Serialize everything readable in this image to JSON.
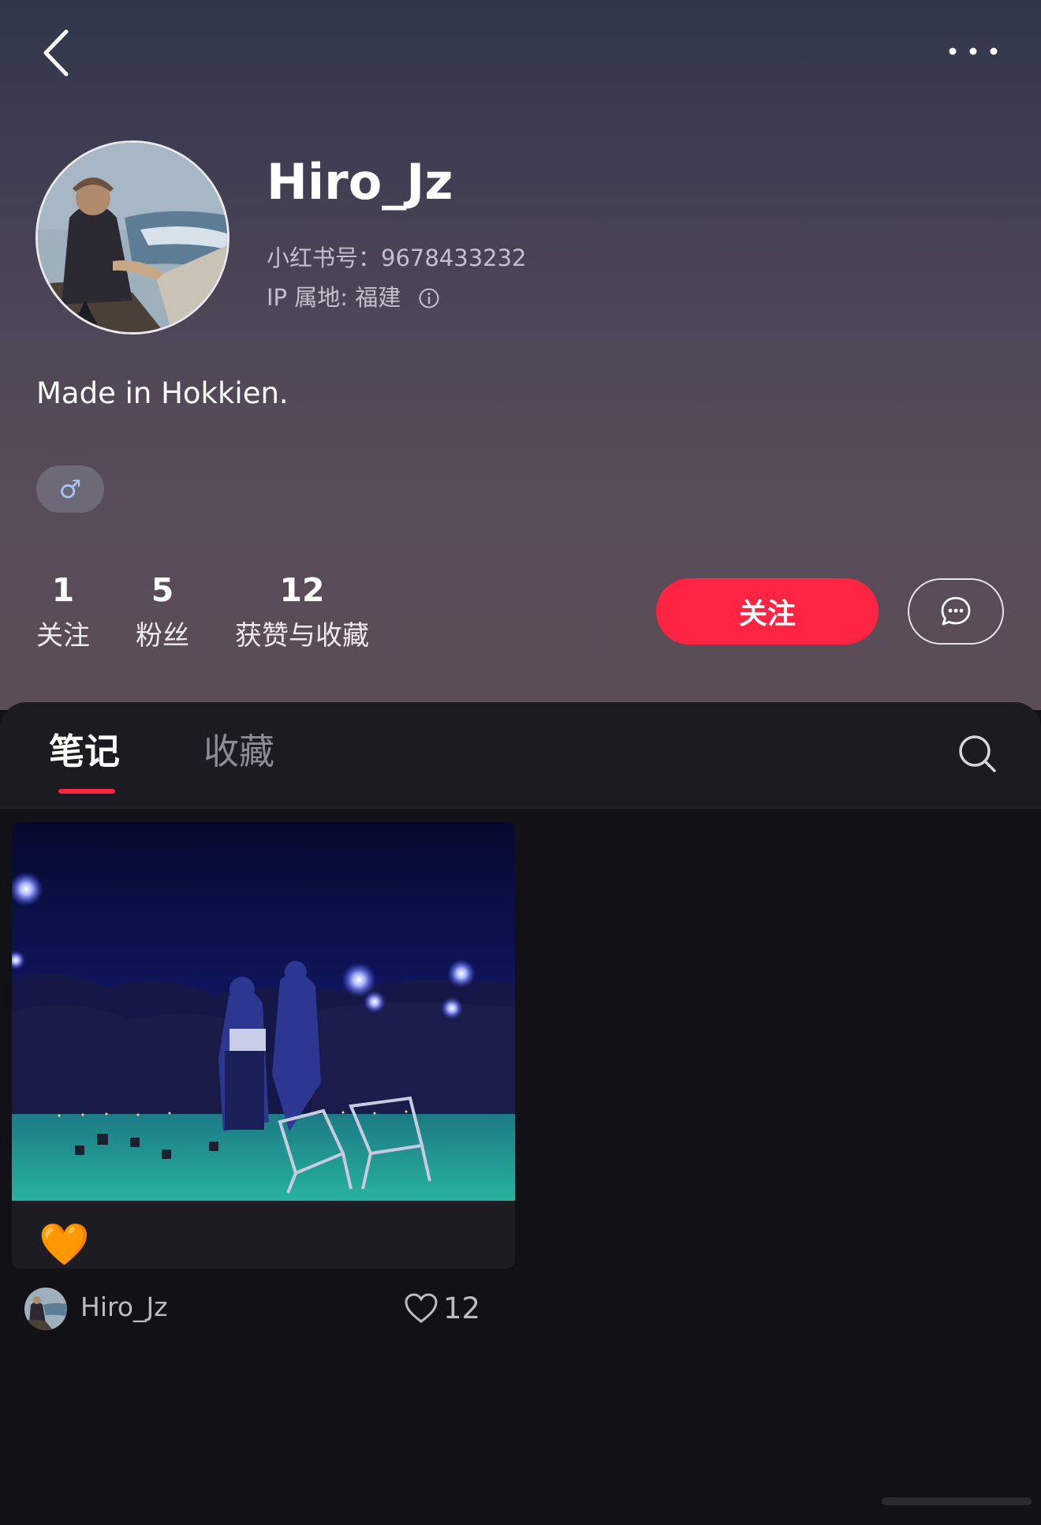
{
  "profile": {
    "username": "Hiro_Jz",
    "redbook_id": "小红书号：9678433232",
    "ip_location": "IP 属地: 福建",
    "bio": "Made in Hokkien.",
    "gender_symbol": "♂"
  },
  "stats": [
    {
      "value": "1",
      "label": "关注"
    },
    {
      "value": "5",
      "label": "粉丝"
    },
    {
      "value": "12",
      "label": "获赞与收藏"
    }
  ],
  "actions": {
    "follow_label": "关注"
  },
  "tabs": [
    {
      "label": "笔记",
      "active": true
    },
    {
      "label": "收藏",
      "active": false
    }
  ],
  "notes": [
    {
      "title": "🧡",
      "author": "Hiro_Jz",
      "likes": "12"
    }
  ],
  "icons": {
    "back": "back-chevron-icon",
    "more": "more-dots-icon",
    "info": "info-icon",
    "message": "chat-bubble-icon",
    "search": "search-icon",
    "like": "heart-outline-icon"
  },
  "colors": {
    "accent": "#ff2442",
    "panel_bg": "#121116"
  }
}
